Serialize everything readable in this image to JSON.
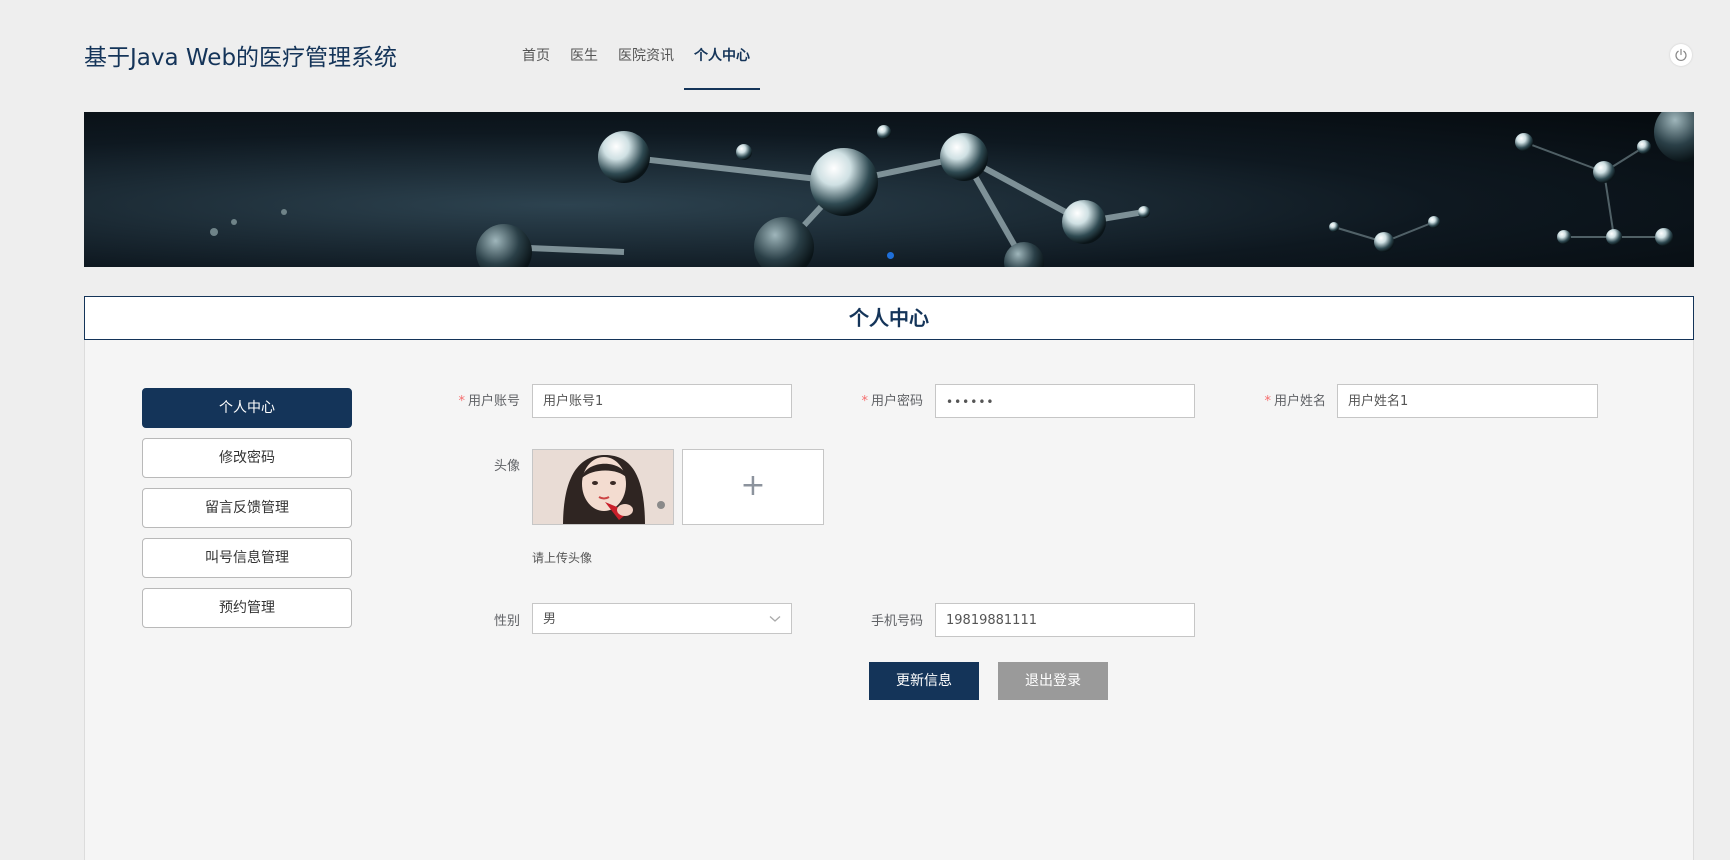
{
  "header": {
    "site_title": "基于Java Web的医疗管理系统",
    "nav": [
      {
        "label": "首页",
        "active": false
      },
      {
        "label": "医生",
        "active": false
      },
      {
        "label": "医院资讯",
        "active": false
      },
      {
        "label": "个人中心",
        "active": true
      }
    ],
    "power_icon": "power-icon"
  },
  "panel": {
    "title": "个人中心"
  },
  "sidebar": {
    "items": [
      {
        "label": "个人中心",
        "active": true
      },
      {
        "label": "修改密码",
        "active": false
      },
      {
        "label": "留言反馈管理",
        "active": false
      },
      {
        "label": "叫号信息管理",
        "active": false
      },
      {
        "label": "预约管理",
        "active": false
      }
    ]
  },
  "form": {
    "account": {
      "label": "用户账号",
      "value": "用户账号1",
      "required": true
    },
    "password": {
      "label": "用户密码",
      "value": "••••••",
      "required": true
    },
    "name": {
      "label": "用户姓名",
      "value": "用户姓名1",
      "required": true
    },
    "avatar": {
      "label": "头像",
      "hint": "请上传头像",
      "upload_icon": "+"
    },
    "gender": {
      "label": "性别",
      "value": "男"
    },
    "phone": {
      "label": "手机号码",
      "value": "19819881111"
    }
  },
  "actions": {
    "update_label": "更新信息",
    "logout_label": "退出登录"
  },
  "colors": {
    "primary": "#143459",
    "required": "#f56c6c",
    "secondary_button": "#9a9a9a",
    "background": "#eeeeee"
  }
}
